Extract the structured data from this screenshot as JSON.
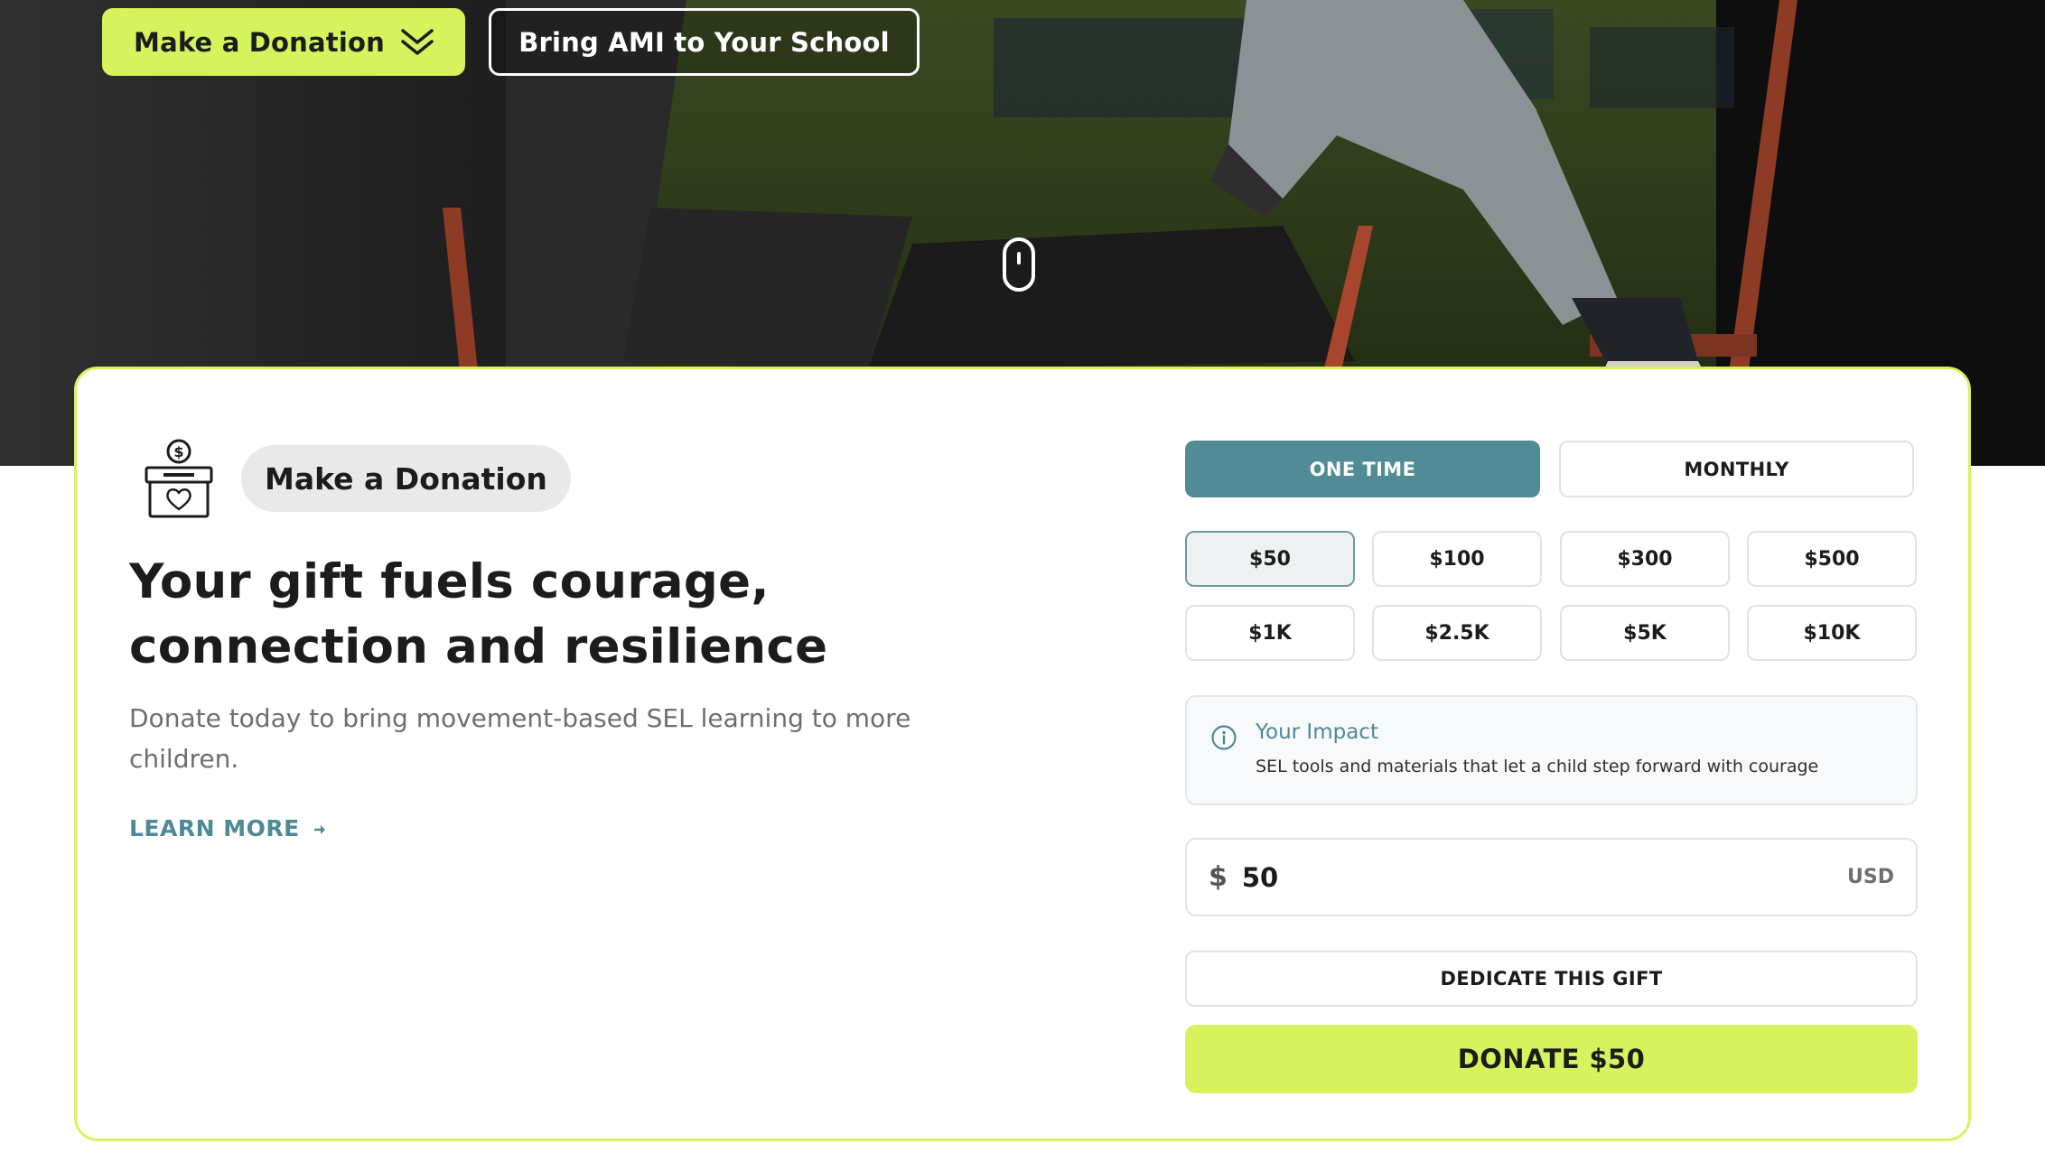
{
  "hero": {
    "donate_button_label": "Make a Donation",
    "school_button_label": "Bring AMI to Your School",
    "scroll_indicator_icon": "mouse-scroll-icon",
    "donate_button_icon": "double-chevron-down-icon"
  },
  "card": {
    "badge_icon": "donation-box-icon",
    "badge_label": "Make a Donation",
    "headline_line1": "Your gift fuels courage,",
    "headline_line2": "connection and resilience",
    "subtext": "Donate today to bring movement-based SEL learning to more children.",
    "learn_more_label": "LEARN MORE",
    "learn_more_icon": "arrow-right-icon"
  },
  "donation_form": {
    "frequency": {
      "options": [
        "ONE TIME",
        "MONTHLY"
      ],
      "selected": "ONE TIME"
    },
    "amounts": [
      "$50",
      "$100",
      "$300",
      "$500",
      "$1K",
      "$2.5K",
      "$5K",
      "$10K"
    ],
    "selected_amount": "$50",
    "impact": {
      "icon": "info-icon",
      "title": "Your Impact",
      "description": "SEL tools and materials that let a child step forward with courage"
    },
    "amount_input": {
      "currency_symbol": "$",
      "value": "50",
      "currency_code": "USD"
    },
    "dedicate_label": "DEDICATE THIS GIFT",
    "donate_label": "DONATE $50"
  },
  "colors": {
    "accent_lime": "#d6f35e",
    "accent_teal": "#518b96",
    "link_teal": "#4d8a95",
    "card_border": "#d6f35e",
    "text_dark": "#1c1c1c",
    "text_muted": "#6e6e6e"
  }
}
